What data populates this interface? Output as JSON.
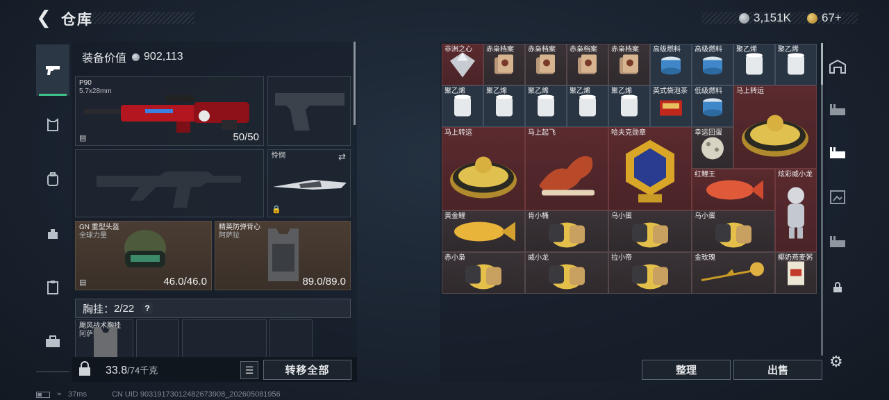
{
  "header": {
    "title": "仓库",
    "currency_silver": "3,151K",
    "currency_gold": "67+"
  },
  "nav_left": [
    "pistol-icon",
    "armor-icon",
    "backpack-icon",
    "bag-icon",
    "clipboard-icon",
    "toolbox-icon"
  ],
  "equipment": {
    "value_label": "装备价值",
    "value": "902,113",
    "primary_weapon": {
      "name": "P90",
      "ammo": "5.7x28mm",
      "durability": "50/50"
    },
    "knife": {
      "name": "怜悯"
    },
    "helmet": {
      "name": "GN 重型头盔",
      "sub": "全球力量",
      "durability": "46.0/46.0"
    },
    "vest": {
      "name": "精英防弹背心",
      "sub": "阿萨拉",
      "durability": "89.0/89.0"
    },
    "chest_rig": {
      "label": "胸挂：",
      "count": "2/22",
      "help": "?"
    },
    "rig_item": {
      "name": "飓风战术胸挂",
      "sub": "阿萨拉"
    }
  },
  "bottom_bar": {
    "weight_value": "33.8",
    "weight_max": "/74千克",
    "move_all": "转移全部"
  },
  "status_bar": {
    "ping": "37ms",
    "uid": "CN UID 9031917301248267390​8_202605081956"
  },
  "storage": {
    "cells": [
      {
        "label": "非洲之心",
        "color": "red",
        "icon": "diamond"
      },
      {
        "label": "赤枭档案",
        "color": "dark",
        "icon": "file"
      },
      {
        "label": "赤枭档案",
        "color": "dark",
        "icon": "file"
      },
      {
        "label": "赤枭档案",
        "color": "dark",
        "icon": "file"
      },
      {
        "label": "赤枭档案",
        "color": "dark",
        "icon": "file"
      },
      {
        "label": "高级燃料",
        "color": "blue",
        "icon": "fuel"
      },
      {
        "label": "高级燃料",
        "color": "blue",
        "icon": "fuel"
      },
      {
        "label": "聚乙烯",
        "color": "blue",
        "icon": "roll"
      },
      {
        "label": "聚乙烯",
        "color": "blue",
        "icon": "roll"
      },
      {
        "label": "聚乙烯",
        "color": "blue",
        "icon": "roll"
      },
      {
        "label": "聚乙烯",
        "color": "blue",
        "icon": "roll"
      },
      {
        "label": "聚乙烯",
        "color": "blue",
        "icon": "roll"
      },
      {
        "label": "聚乙烯",
        "color": "blue",
        "icon": "roll"
      },
      {
        "label": "聚乙烯",
        "color": "blue",
        "icon": "roll"
      },
      {
        "label": "英式袋泡茶",
        "color": "blue",
        "icon": "tea"
      },
      {
        "label": "低级燃料",
        "color": "blue",
        "icon": "fuel"
      },
      {
        "label": "马上转运",
        "color": "red",
        "icon": "coin"
      },
      {
        "label": "马上转运",
        "color": "red",
        "icon": "coin"
      },
      {
        "label": "马上起飞",
        "color": "red",
        "icon": "horse"
      },
      {
        "label": "哈夫克勋章",
        "color": "red",
        "icon": "medal"
      },
      {
        "label": "幸运回蛋",
        "color": "dark",
        "icon": "egg"
      },
      {
        "label": "红鲤王",
        "color": "red",
        "icon": "fish-red"
      },
      {
        "label": "炫彩威小龙",
        "color": "red",
        "icon": "figure"
      },
      {
        "label": "黄金鲤",
        "color": "dark",
        "icon": "fish-gold"
      },
      {
        "label": "肯小桶",
        "color": "dark",
        "icon": "toy"
      },
      {
        "label": "乌小蛋",
        "color": "dark",
        "icon": "toy"
      },
      {
        "label": "乌小蛋",
        "color": "dark",
        "icon": "toy"
      },
      {
        "label": "赤小枭",
        "color": "dark",
        "icon": "toy"
      },
      {
        "label": "威小龙",
        "color": "dark",
        "icon": "toy"
      },
      {
        "label": "拉小帝",
        "color": "dark",
        "icon": "toy"
      },
      {
        "label": "金玫瑰",
        "color": "dark",
        "icon": "rose"
      },
      {
        "label": "椰奶燕麦粥",
        "color": "dark",
        "icon": "box"
      }
    ],
    "sort_label": "整理",
    "sell_label": "出售"
  }
}
